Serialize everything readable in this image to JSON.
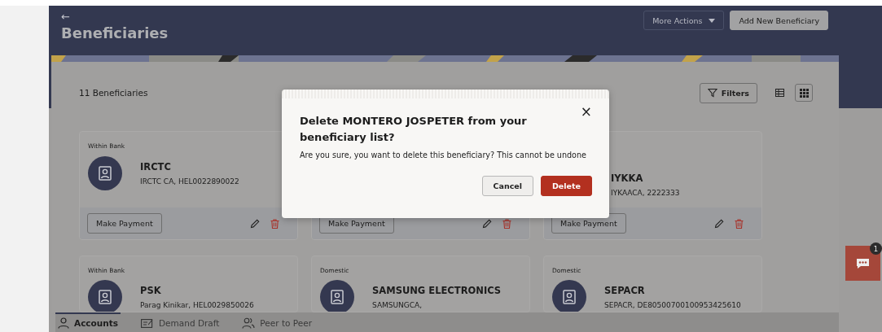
{
  "header": {
    "back": "←",
    "title": "Beneficiaries",
    "actions": [
      {
        "label": "More Actions",
        "kind": "dropdown"
      },
      {
        "label": "Add New Beneficiary",
        "kind": "primary"
      }
    ]
  },
  "summary": {
    "count": "11 Beneficiaries",
    "filters": "Filters",
    "views": [
      {
        "kind": "table",
        "selected": false
      },
      {
        "kind": "grid",
        "selected": true
      }
    ]
  },
  "cards": [
    {
      "kind": "full",
      "category": "Within Bank",
      "name": "IRCTC",
      "detail": "IRCTC CA, HEL0022890022",
      "action": "Make Payment"
    },
    {
      "kind": "footer_only",
      "action": "Make Payment"
    },
    {
      "kind": "covered",
      "name": "IYKKA",
      "detail": "IYKAACA, 2222333",
      "action": "Make Payment"
    },
    {
      "kind": "full",
      "category": "Within Bank",
      "name": "PSK",
      "detail": "Parag Kinikar, HEL0029850026"
    },
    {
      "kind": "full",
      "category": "Domestic",
      "name": "SAMSUNG ELECTRONICS",
      "detail": "SAMSUNGCA,"
    },
    {
      "kind": "full",
      "category": "Domestic",
      "name": "SEPACR",
      "detail": "SEPACR, DE80500700100953425610"
    }
  ],
  "tabs": [
    {
      "label": "Accounts",
      "selected": true
    },
    {
      "label": "Demand Draft",
      "selected": false
    },
    {
      "label": "Peer to Peer",
      "selected": false
    }
  ],
  "dialog": {
    "title": "Delete MONTERO JOSPETER from your beneficiary list?",
    "message": "Are you sure, you want to delete this beneficiary? This cannot be undone",
    "close": "×",
    "buttons": [
      {
        "label": "Cancel",
        "kind": "secondary"
      },
      {
        "label": "Delete",
        "kind": "danger"
      }
    ]
  },
  "chat": {
    "badge": "1"
  }
}
